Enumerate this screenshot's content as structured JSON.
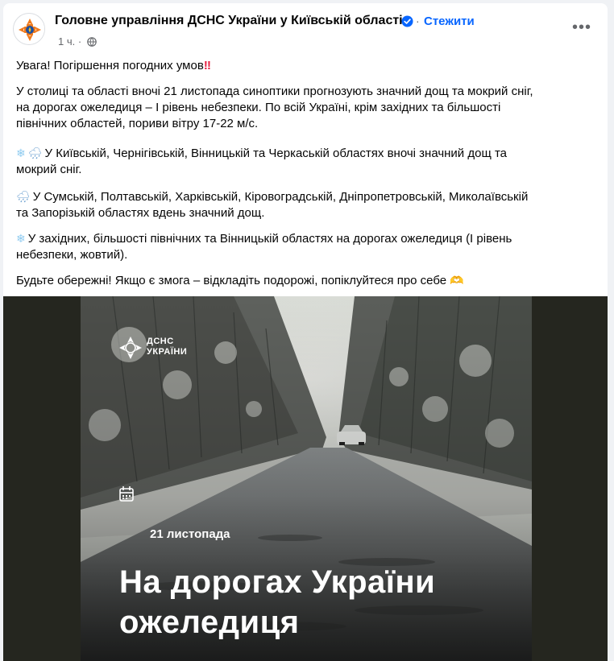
{
  "post": {
    "page_name": "Головне управління ДСНС України у Київській області",
    "follow_label": "Стежити",
    "separator": "·",
    "time": "1 ч.",
    "meta_separator": "·",
    "more_label": "•••",
    "headline": "Увага! Погіршення погодних умов",
    "warning_emoji": "‼",
    "paragraph1_line1": "У столиці та області вночі 21 листопада синоптики прогнозують значний дощ та мокрий сніг,",
    "paragraph1_line2": "на дорогах ожеледиця – I рівень небезпеки. По всій Україні, крім західних та більшості",
    "paragraph1_line3": "північних областей, пориви вітру 17-22 м/с.",
    "paragraph2_line1": "У Київській, Чернігівській, Вінницькій та Черкаській областях вночі значний дощ та",
    "paragraph2_line2": "мокрий сніг.",
    "paragraph3_line1": "У Сумській, Полтавській, Харківській, Кіровоградській, Дніпропетровській, Миколаївській",
    "paragraph3_line2": "та Запорізькій областях вдень значний дощ.",
    "paragraph4_line1": "У західних, більшості північних та Вінницькій областях на дорогах ожеледиця (І рівень",
    "paragraph4_line2": "небезпеки, жовтий).",
    "closing": "Будьте обережні! Якщо є змога – відкладіть подорожі, попіклуйтеся про себе",
    "snow_emoji": "❄",
    "rain_emoji": "🌧",
    "hug_emoji": "🫶"
  },
  "image": {
    "logo_line1": "ДСНС",
    "logo_line2": "УКРАЇНИ",
    "date_label": "21 листопада",
    "title_line1": "На дорогах України",
    "title_line2": "ожеледиця"
  },
  "icons": {
    "verified": "verified-badge-icon",
    "globe": "globe-icon",
    "calendar": "calendar-icon",
    "more": "more-options-icon"
  },
  "colors": {
    "accent": "#0866ff",
    "secondary_text": "#65676b",
    "warning": "#e41e3f",
    "image_background": "#25261f"
  }
}
